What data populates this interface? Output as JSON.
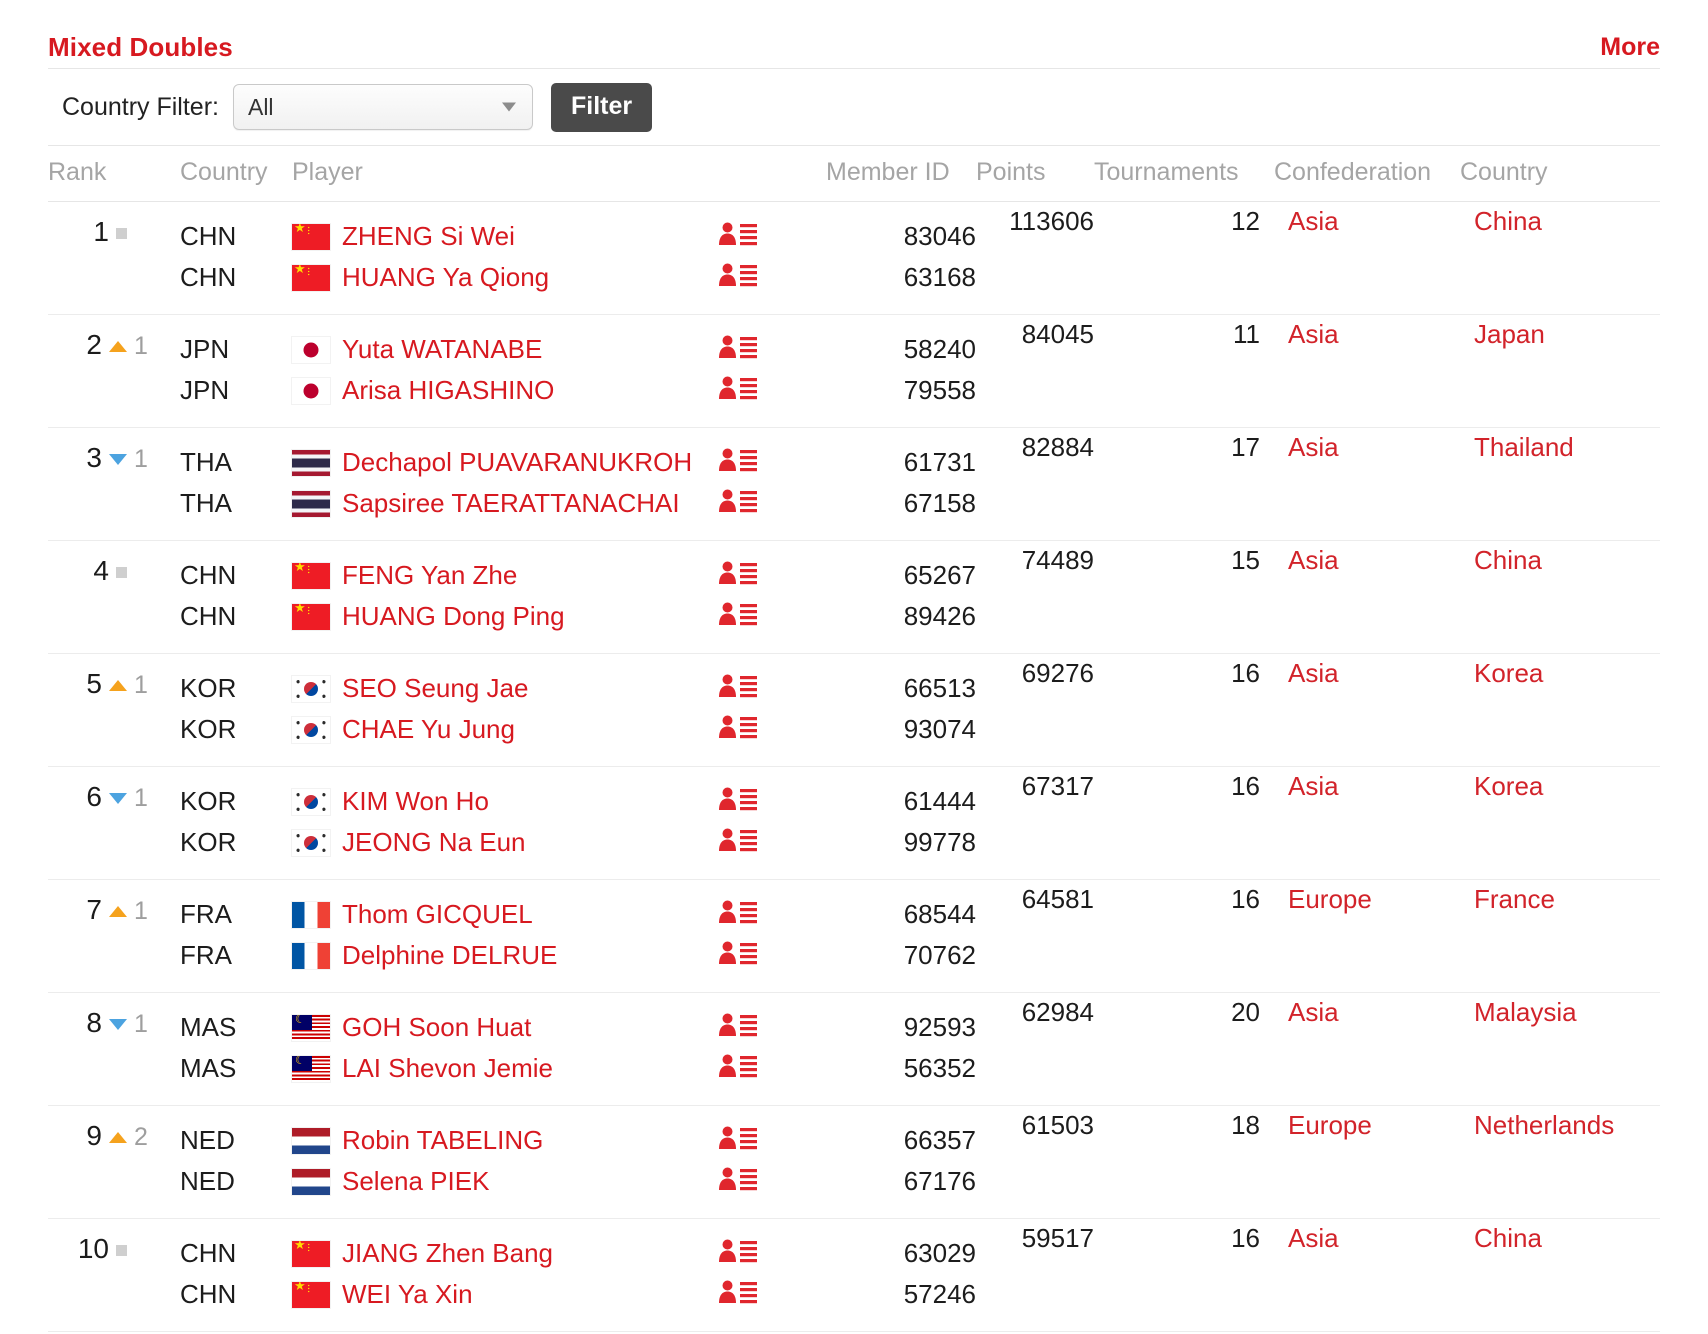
{
  "header": {
    "discipline_title": "Mixed Doubles",
    "more_label": "More"
  },
  "filter": {
    "label": "Country Filter:",
    "selected": "All",
    "button_label": "Filter"
  },
  "columns": {
    "rank": "Rank",
    "nat": "Country",
    "player": "Player",
    "icon": "",
    "member_id": "Member ID",
    "points": "Points",
    "tournaments": "Tournaments",
    "confederation": "Confederation",
    "country": "Country"
  },
  "colors": {
    "brand_red": "#d71920",
    "link_red": "#d2232a",
    "up_orange": "#f5a21d",
    "down_blue": "#4ca3e0",
    "same_gray": "#cfcfcf",
    "filter_button": "#4a4a4a"
  },
  "rows": [
    {
      "rank": "1",
      "move_dir": "same",
      "move_amount": "",
      "players": [
        {
          "nat": "CHN",
          "flag": "chn",
          "name": "ZHENG Si Wei",
          "member_id": "83046"
        },
        {
          "nat": "CHN",
          "flag": "chn",
          "name": "HUANG Ya Qiong",
          "member_id": "63168"
        }
      ],
      "points": "113606",
      "tournaments": "12",
      "confederation": "Asia",
      "country": "China"
    },
    {
      "rank": "2",
      "move_dir": "up",
      "move_amount": "1",
      "players": [
        {
          "nat": "JPN",
          "flag": "jpn",
          "name": "Yuta WATANABE",
          "member_id": "58240"
        },
        {
          "nat": "JPN",
          "flag": "jpn",
          "name": "Arisa HIGASHINO",
          "member_id": "79558"
        }
      ],
      "points": "84045",
      "tournaments": "11",
      "confederation": "Asia",
      "country": "Japan"
    },
    {
      "rank": "3",
      "move_dir": "down",
      "move_amount": "1",
      "players": [
        {
          "nat": "THA",
          "flag": "tha",
          "name": "Dechapol PUAVARANUKROH",
          "member_id": "61731"
        },
        {
          "nat": "THA",
          "flag": "tha",
          "name": "Sapsiree TAERATTANACHAI",
          "member_id": "67158"
        }
      ],
      "points": "82884",
      "tournaments": "17",
      "confederation": "Asia",
      "country": "Thailand"
    },
    {
      "rank": "4",
      "move_dir": "same",
      "move_amount": "",
      "players": [
        {
          "nat": "CHN",
          "flag": "chn",
          "name": "FENG Yan Zhe",
          "member_id": "65267"
        },
        {
          "nat": "CHN",
          "flag": "chn",
          "name": "HUANG Dong Ping",
          "member_id": "89426"
        }
      ],
      "points": "74489",
      "tournaments": "15",
      "confederation": "Asia",
      "country": "China"
    },
    {
      "rank": "5",
      "move_dir": "up",
      "move_amount": "1",
      "players": [
        {
          "nat": "KOR",
          "flag": "kor",
          "name": "SEO Seung Jae",
          "member_id": "66513"
        },
        {
          "nat": "KOR",
          "flag": "kor",
          "name": "CHAE Yu Jung",
          "member_id": "93074"
        }
      ],
      "points": "69276",
      "tournaments": "16",
      "confederation": "Asia",
      "country": "Korea"
    },
    {
      "rank": "6",
      "move_dir": "down",
      "move_amount": "1",
      "players": [
        {
          "nat": "KOR",
          "flag": "kor",
          "name": "KIM Won Ho",
          "member_id": "61444"
        },
        {
          "nat": "KOR",
          "flag": "kor",
          "name": "JEONG Na Eun",
          "member_id": "99778"
        }
      ],
      "points": "67317",
      "tournaments": "16",
      "confederation": "Asia",
      "country": "Korea"
    },
    {
      "rank": "7",
      "move_dir": "up",
      "move_amount": "1",
      "players": [
        {
          "nat": "FRA",
          "flag": "fra",
          "name": "Thom GICQUEL",
          "member_id": "68544"
        },
        {
          "nat": "FRA",
          "flag": "fra",
          "name": "Delphine DELRUE",
          "member_id": "70762"
        }
      ],
      "points": "64581",
      "tournaments": "16",
      "confederation": "Europe",
      "country": "France"
    },
    {
      "rank": "8",
      "move_dir": "down",
      "move_amount": "1",
      "players": [
        {
          "nat": "MAS",
          "flag": "mas",
          "name": "GOH Soon Huat",
          "member_id": "92593"
        },
        {
          "nat": "MAS",
          "flag": "mas",
          "name": "LAI Shevon Jemie",
          "member_id": "56352"
        }
      ],
      "points": "62984",
      "tournaments": "20",
      "confederation": "Asia",
      "country": "Malaysia"
    },
    {
      "rank": "9",
      "move_dir": "up",
      "move_amount": "2",
      "players": [
        {
          "nat": "NED",
          "flag": "ned",
          "name": "Robin TABELING",
          "member_id": "66357"
        },
        {
          "nat": "NED",
          "flag": "ned",
          "name": "Selena PIEK",
          "member_id": "67176"
        }
      ],
      "points": "61503",
      "tournaments": "18",
      "confederation": "Europe",
      "country": "Netherlands"
    },
    {
      "rank": "10",
      "move_dir": "same",
      "move_amount": "",
      "players": [
        {
          "nat": "CHN",
          "flag": "chn",
          "name": "JIANG Zhen Bang",
          "member_id": "63029"
        },
        {
          "nat": "CHN",
          "flag": "chn",
          "name": "WEI Ya Xin",
          "member_id": "57246"
        }
      ],
      "points": "59517",
      "tournaments": "16",
      "confederation": "Asia",
      "country": "China"
    }
  ],
  "icons": {
    "profile": "player-profile-icon",
    "caret": "chevron-down-icon"
  }
}
